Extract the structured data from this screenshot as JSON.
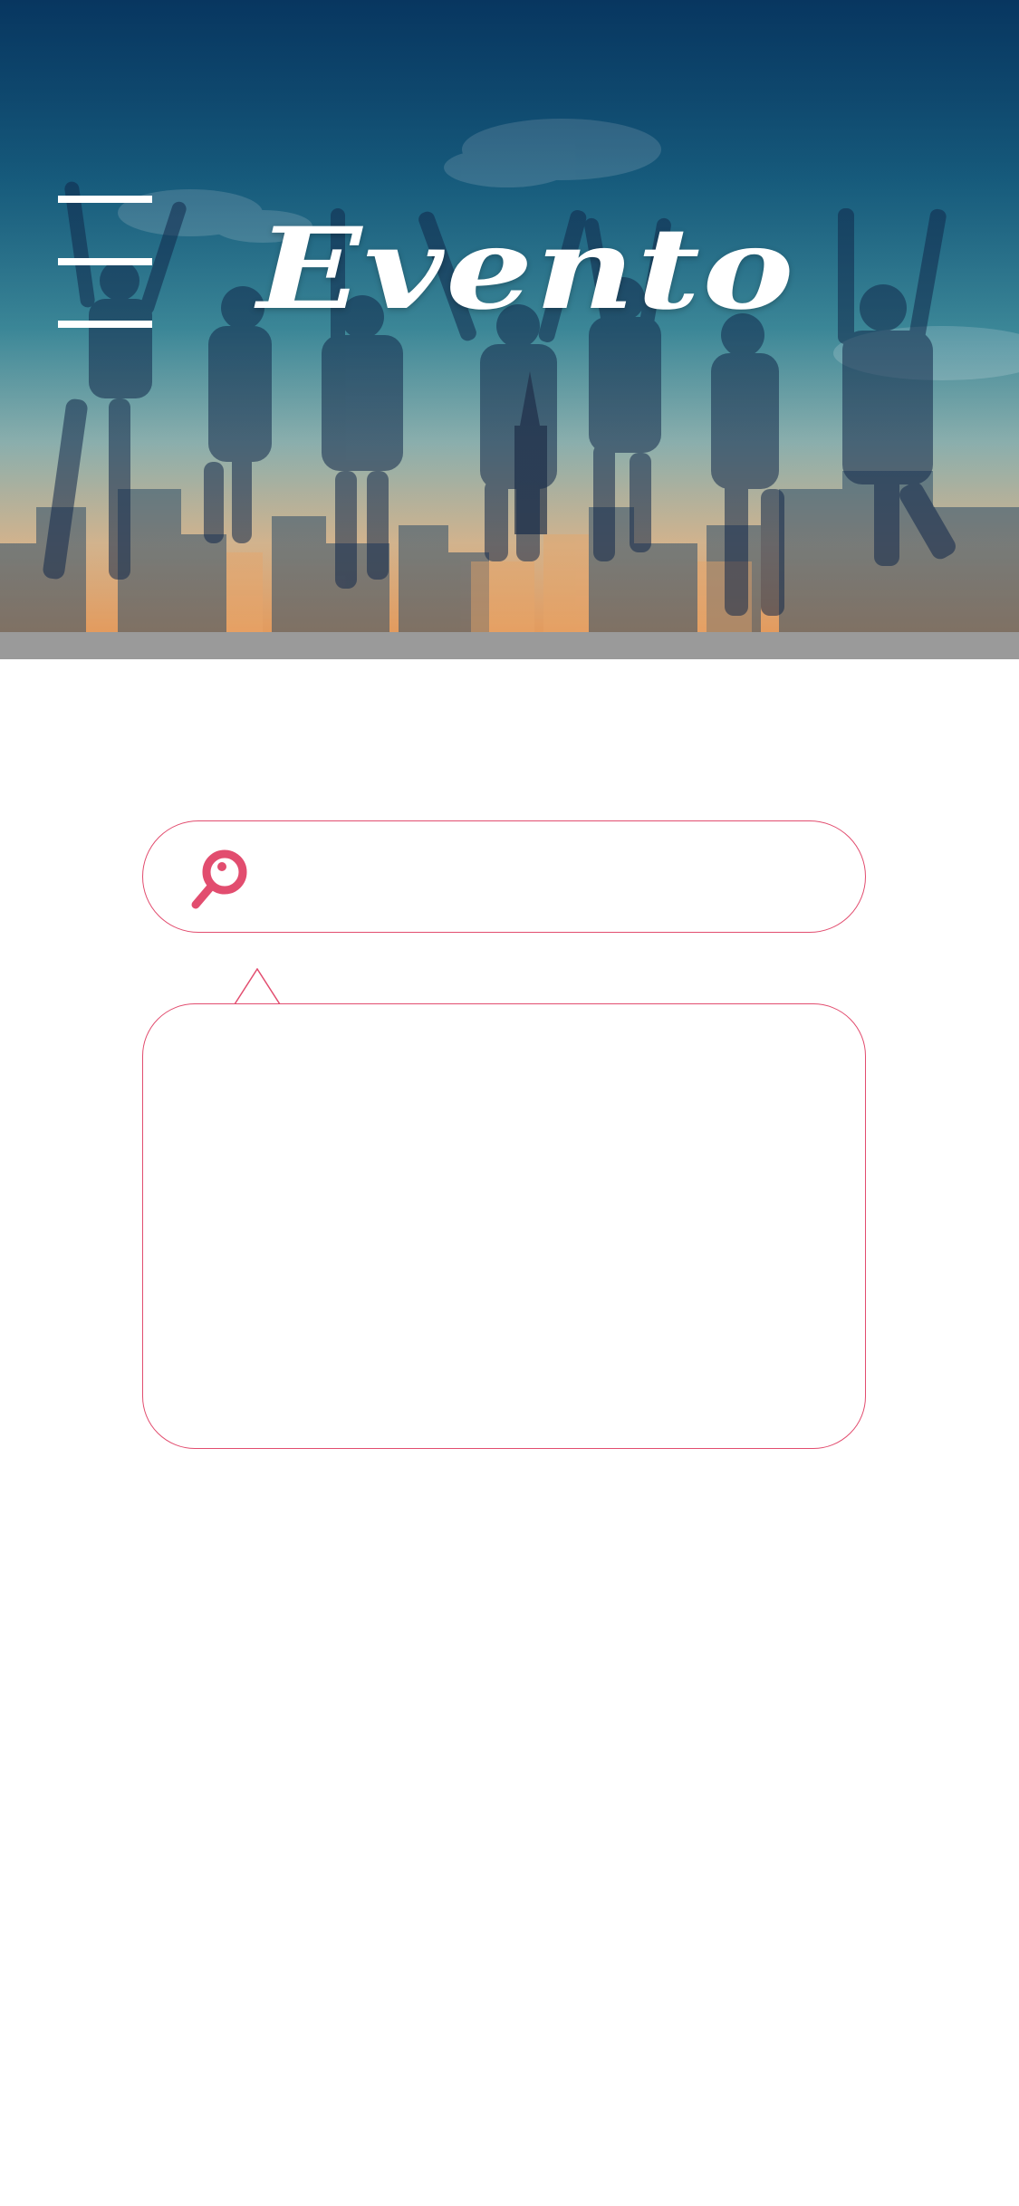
{
  "app": {
    "brand_title": "Evento"
  },
  "header": {
    "menu_icon": "hamburger-menu-icon",
    "hero_image": "people-jumping-city-skyline"
  },
  "search": {
    "icon": "search-icon",
    "value": "",
    "placeholder": ""
  },
  "results": {
    "items": []
  },
  "colors": {
    "accent": "#e24d6f",
    "header_bar": "#9a9a9a",
    "background": "#ffffff"
  }
}
